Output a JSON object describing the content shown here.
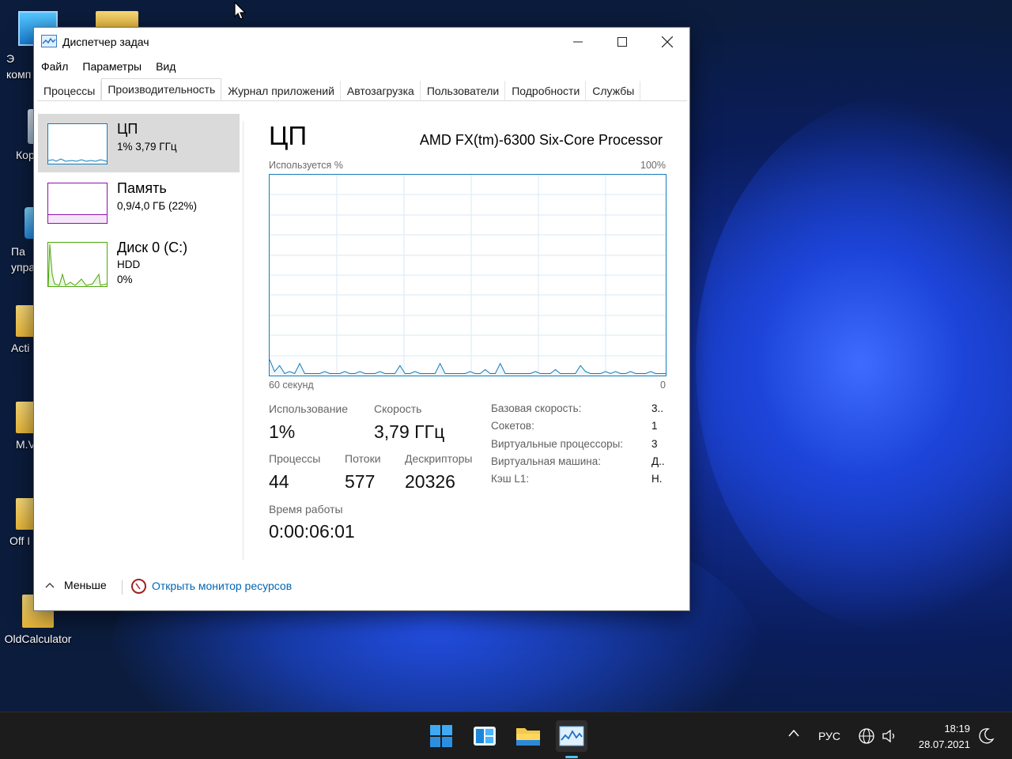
{
  "desktop": {
    "icons": [
      {
        "label": "Э\nкомп"
      },
      {
        "label": "Кор"
      },
      {
        "label": "Па\nупра"
      },
      {
        "label": "Acti"
      },
      {
        "label": "M.V"
      },
      {
        "label": "Off I"
      },
      {
        "label": "OldCalculator"
      }
    ]
  },
  "window": {
    "title": "Диспетчер задач",
    "menu": [
      "Файл",
      "Параметры",
      "Вид"
    ],
    "tabs": [
      "Процессы",
      "Производительность",
      "Журнал приложений",
      "Автозагрузка",
      "Пользователи",
      "Подробности",
      "Службы"
    ],
    "active_tab": "Производительность"
  },
  "resources": [
    {
      "name": "ЦП",
      "line1": "1% 3,79 ГГц",
      "line2": "",
      "color": "#117dbb"
    },
    {
      "name": "Память",
      "line1": "0,9/4,0 ГБ (22%)",
      "line2": "",
      "color": "#8b12ae"
    },
    {
      "name": "Диск 0 (C:)",
      "line1": "HDD",
      "line2": "0%",
      "color": "#4da60c"
    }
  ],
  "cpu": {
    "title": "ЦП",
    "model": "AMD FX(tm)-6300 Six-Core Processor",
    "graph_label_left": "Используется %",
    "graph_label_right": "100%",
    "time_left": "60 секунд",
    "time_right": "0",
    "usage_series": [
      8,
      2,
      5,
      1,
      2,
      1,
      6,
      1,
      1,
      1,
      1,
      2,
      1,
      1,
      1,
      2,
      1,
      1,
      2,
      1,
      1,
      1,
      2,
      1,
      1,
      1,
      5,
      1,
      1,
      2,
      1,
      1,
      1,
      1,
      6,
      1,
      1,
      1,
      1,
      1,
      2,
      1,
      1,
      3,
      1,
      1,
      6,
      1,
      1,
      1,
      1,
      1,
      1,
      2,
      1,
      1,
      1,
      3,
      1,
      1,
      1,
      1,
      5,
      2,
      1,
      1,
      1,
      2,
      1,
      2,
      1,
      1,
      2,
      1,
      1,
      1,
      2,
      1,
      1,
      1
    ],
    "stats": {
      "usage_label": "Использование",
      "usage_value": "1%",
      "speed_label": "Скорость",
      "speed_value": "3,79 ГГц",
      "processes_label": "Процессы",
      "processes_value": "44",
      "threads_label": "Потоки",
      "threads_value": "577",
      "handles_label": "Дескрипторы",
      "handles_value": "20326",
      "uptime_label": "Время работы",
      "uptime_value": "0:00:06:01"
    },
    "details": [
      {
        "label": "Базовая скорость:",
        "value": "3.."
      },
      {
        "label": "Сокетов:",
        "value": "1"
      },
      {
        "label": "Виртуальные процессоры:",
        "value": "3"
      },
      {
        "label": "Виртуальная машина:",
        "value": "Д.."
      },
      {
        "label": "Кэш L1:",
        "value": "Н."
      }
    ]
  },
  "footer": {
    "less_label": "Меньше",
    "resmon_link": "Открыть монитор ресурсов"
  },
  "taskbar": {
    "lang": "РУС",
    "time": "18:19",
    "date": "28.07.2021"
  },
  "colors": {
    "cpu_graph": "#117dbb",
    "memory_graph": "#8b12ae",
    "disk_graph": "#4da60c",
    "link": "#0066b4"
  }
}
